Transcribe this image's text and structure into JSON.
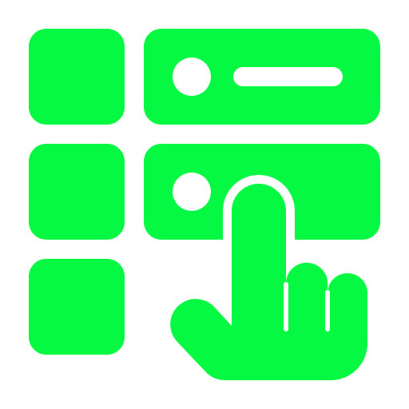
{
  "icon": {
    "name": "select-list-item-icon",
    "description_tokens": [
      "grid-tile-icon",
      "list-row-icon",
      "tap-hand-icon"
    ],
    "colors": {
      "primary": "#05F943",
      "background": "#FFFFFF",
      "cutout": "#FFFFFF"
    },
    "tiles": [
      {
        "name": "tile-top-left"
      },
      {
        "name": "tile-middle-left"
      },
      {
        "name": "tile-bottom-left"
      }
    ],
    "rows": [
      {
        "name": "list-row-top",
        "has_line": true
      },
      {
        "name": "list-row-middle",
        "has_line": false
      }
    ],
    "hand": {
      "name": "pointing-hand-icon",
      "gesture": "tap"
    }
  }
}
